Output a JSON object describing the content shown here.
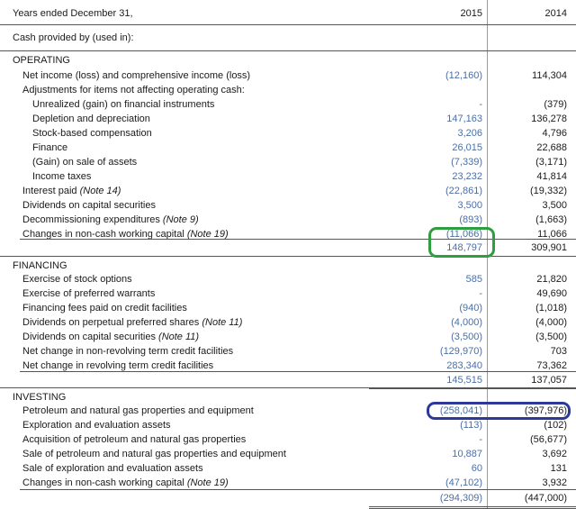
{
  "header": {
    "label": "Years ended December 31,",
    "col_2015": "2015",
    "col_2014": "2014"
  },
  "intro": "Cash provided by (used in):",
  "operating": {
    "title": "OPERATING",
    "rows": [
      {
        "label": "Net income (loss) and comprehensive income (loss)",
        "note": "",
        "v2015": "(12,160)",
        "v2014": "114,304",
        "indent": 1
      },
      {
        "label": "Adjustments for items not affecting operating cash:",
        "note": "",
        "v2015": "",
        "v2014": "",
        "indent": 1
      },
      {
        "label": "Unrealized (gain) on financial instruments",
        "note": "",
        "v2015": "-",
        "v2014": "(379)",
        "indent": 2
      },
      {
        "label": "Depletion and depreciation",
        "note": "",
        "v2015": "147,163",
        "v2014": "136,278",
        "indent": 2
      },
      {
        "label": "Stock-based compensation",
        "note": "",
        "v2015": "3,206",
        "v2014": "4,796",
        "indent": 2
      },
      {
        "label": "Finance",
        "note": "",
        "v2015": "26,015",
        "v2014": "22,688",
        "indent": 2
      },
      {
        "label": "(Gain) on sale of assets",
        "note": "",
        "v2015": "(7,339)",
        "v2014": "(3,171)",
        "indent": 2
      },
      {
        "label": "Income taxes",
        "note": "",
        "v2015": "23,232",
        "v2014": "41,814",
        "indent": 2
      },
      {
        "label": "Interest paid ",
        "note": "(Note 14)",
        "v2015": "(22,861)",
        "v2014": "(19,332)",
        "indent": 1
      },
      {
        "label": "Dividends on capital securities",
        "note": "",
        "v2015": "3,500",
        "v2014": "3,500",
        "indent": 1
      },
      {
        "label": "Decommissioning expenditures ",
        "note": "(Note 9)",
        "v2015": "(893)",
        "v2014": "(1,663)",
        "indent": 1
      },
      {
        "label": "Changes in non-cash working capital ",
        "note": "(Note 19)",
        "v2015": "(11,066)",
        "v2014": "11,066",
        "indent": 1
      }
    ],
    "total": {
      "v2015": "148,797",
      "v2014": "309,901"
    }
  },
  "financing": {
    "title": "FINANCING",
    "rows": [
      {
        "label": "Exercise of stock options",
        "note": "",
        "v2015": "585",
        "v2014": "21,820",
        "indent": 1
      },
      {
        "label": "Exercise of preferred warrants",
        "note": "",
        "v2015": "-",
        "v2014": "49,690",
        "indent": 1
      },
      {
        "label": "Financing fees paid on credit facilities",
        "note": "",
        "v2015": "(940)",
        "v2014": "(1,018)",
        "indent": 1
      },
      {
        "label": "Dividends on perpetual preferred shares ",
        "note": "(Note 11)",
        "v2015": "(4,000)",
        "v2014": "(4,000)",
        "indent": 1
      },
      {
        "label": "Dividends on capital securities ",
        "note": "(Note 11)",
        "v2015": "(3,500)",
        "v2014": "(3,500)",
        "indent": 1
      },
      {
        "label": "Net change in non-revolving term credit facilities",
        "note": "",
        "v2015": "(129,970)",
        "v2014": "703",
        "indent": 1
      },
      {
        "label": "Net change in revolving term credit facilities",
        "note": "",
        "v2015": "283,340",
        "v2014": "73,362",
        "indent": 1
      }
    ],
    "total": {
      "v2015": "145,515",
      "v2014": "137,057"
    }
  },
  "investing": {
    "title": "INVESTING",
    "rows": [
      {
        "label": "Petroleum and natural gas properties and equipment",
        "note": "",
        "v2015": "(258,041)",
        "v2014": "(397,976)",
        "indent": 1
      },
      {
        "label": "Exploration and evaluation assets",
        "note": "",
        "v2015": "(113)",
        "v2014": "(102)",
        "indent": 1
      },
      {
        "label": "Acquisition of petroleum and natural gas properties",
        "note": "",
        "v2015": "-",
        "v2014": "(56,677)",
        "indent": 1
      },
      {
        "label": "Sale of petroleum and natural gas properties and equipment",
        "note": "",
        "v2015": "10,887",
        "v2014": "3,692",
        "indent": 1
      },
      {
        "label": "Sale of exploration and evaluation assets",
        "note": "",
        "v2015": "60",
        "v2014": "131",
        "indent": 1
      },
      {
        "label": "Changes in non-cash working capital ",
        "note": "(Note 19)",
        "v2015": "(47,102)",
        "v2014": "3,932",
        "indent": 1
      }
    ],
    "total": {
      "v2015": "(294,309)",
      "v2014": "(447,000)"
    }
  },
  "annotations": {
    "green_color": "#2e9e3e",
    "blue_color": "#2b3a9a"
  }
}
